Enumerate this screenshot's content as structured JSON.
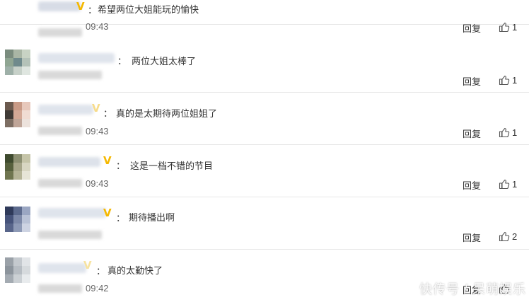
{
  "colors": {
    "vip_badge": "#f5b800",
    "divider": "#e6e6e6",
    "text": "#333333",
    "timestamp": "#666666"
  },
  "comments": [
    {
      "text": "希望两位大姐能玩的愉快",
      "time": "09:43",
      "reply_label": "回复",
      "likes": "1",
      "vip": true,
      "avatar_colors": [
        "#c9b8de",
        "#b7a3d1",
        "#d8cce8",
        "#a995c6",
        "#cdbfe0",
        "#e0d6ee",
        "#bfb0d8",
        "#d4c8e6",
        "#e8e0f2"
      ]
    },
    {
      "text": "两位大姐太棒了",
      "time": "",
      "reply_label": "回复",
      "likes": "1",
      "vip": false,
      "avatar_colors": [
        "#7a8c7e",
        "#a9b6a5",
        "#c8d3c4",
        "#8fa592",
        "#6f8a8c",
        "#b4c2b8",
        "#9eb0a8",
        "#c7d1c9",
        "#dfe6e0"
      ]
    },
    {
      "text": "真的是太期待两位姐姐了",
      "time": "09:43",
      "reply_label": "回复",
      "likes": "1",
      "vip": true,
      "avatar_colors": [
        "#6b5a4e",
        "#c89a86",
        "#e7c8bb",
        "#3f3a36",
        "#d3a896",
        "#f0dcd3",
        "#7d6e63",
        "#bfa598",
        "#ece2dc"
      ]
    },
    {
      "text": "这是一档不错的节目",
      "time": "09:43",
      "reply_label": "回复",
      "likes": "1",
      "vip": true,
      "avatar_colors": [
        "#3e4a2e",
        "#8c8f72",
        "#c5c4a8",
        "#56603d",
        "#a7a68a",
        "#d8d6c2",
        "#6f754f",
        "#b5b497",
        "#e6e4d6"
      ]
    },
    {
      "text": "期待播出啊",
      "time": "",
      "reply_label": "回复",
      "likes": "2",
      "vip": true,
      "avatar_colors": [
        "#2f3a5a",
        "#5c6a8d",
        "#9aa6c2",
        "#46537a",
        "#7d89a8",
        "#b9c2d6",
        "#58658a",
        "#8e9ab6",
        "#cdd3e2"
      ]
    },
    {
      "text": "真的太勤快了",
      "time": "09:42",
      "reply_label": "回复",
      "likes": "",
      "vip": true,
      "avatar_colors": [
        "#9aa1a8",
        "#c4c9ce",
        "#e1e4e7",
        "#8c949c",
        "#b7bdc3",
        "#d6dadd",
        "#a4abb2",
        "#cbd0d4",
        "#e8ebed"
      ]
    }
  ],
  "watermark": "快传号 / 呆萌娱乐"
}
